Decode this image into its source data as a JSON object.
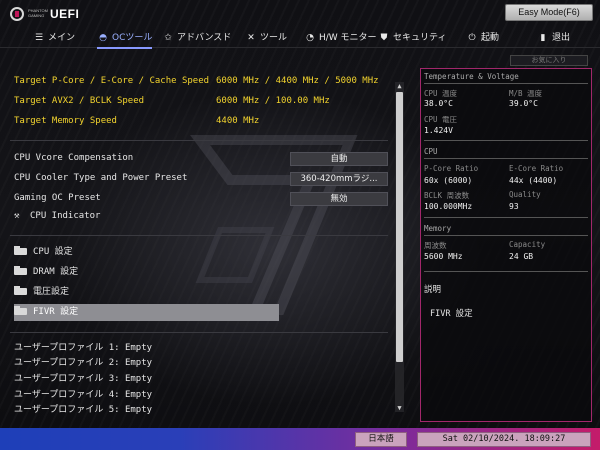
{
  "header": {
    "brand_small": "PHANTOM GAMING",
    "brand_title": "UEFI",
    "easy_mode_label": "Easy Mode(F6)"
  },
  "nav": {
    "tabs": [
      {
        "label": "メイン",
        "icon": "list-icon",
        "active": false
      },
      {
        "label": "OCツール",
        "icon": "speedometer-icon",
        "active": true
      },
      {
        "label": "アドバンスド",
        "icon": "star-icon",
        "active": false
      },
      {
        "label": "ツール",
        "icon": "tools-icon",
        "active": false
      },
      {
        "label": "H/W モニター",
        "icon": "monitor-gauge-icon",
        "active": false
      },
      {
        "label": "セキュリティ",
        "icon": "shield-icon",
        "active": false
      },
      {
        "label": "起動",
        "icon": "power-icon",
        "active": false
      },
      {
        "label": "退出",
        "icon": "exit-icon",
        "active": false
      }
    ],
    "favorites_label": "お気に入り"
  },
  "main": {
    "targets": [
      {
        "label": "Target P-Core / E-Core / Cache Speed",
        "value": "6000 MHz / 4400 MHz / 5000 MHz"
      },
      {
        "label": "Target AVX2 / BCLK Speed",
        "value": "6000 MHz / 100.00 MHz"
      },
      {
        "label": "Target Memory Speed",
        "value": "4400 MHz"
      }
    ],
    "options": [
      {
        "label": "CPU Vcore Compensation",
        "value": "自動"
      },
      {
        "label": "CPU Cooler Type and Power Preset",
        "value": "360-420mmラジ..."
      },
      {
        "label": "Gaming OC Preset",
        "value": "無効"
      }
    ],
    "cpu_indicator_label": "CPU Indicator",
    "folders": [
      {
        "label": "CPU 設定",
        "selected": false
      },
      {
        "label": "DRAM 設定",
        "selected": false
      },
      {
        "label": "電圧設定",
        "selected": false
      },
      {
        "label": "FIVR 設定",
        "selected": true
      }
    ],
    "profiles": [
      "ユーザープロファイル 1: Empty",
      "ユーザープロファイル 2: Empty",
      "ユーザープロファイル 3: Empty",
      "ユーザープロファイル 4: Empty",
      "ユーザープロファイル 5: Empty"
    ]
  },
  "panel": {
    "title": "Temperature & Voltage",
    "cpu_temp_label": "CPU 温度",
    "cpu_temp_value": "38.0°C",
    "mb_temp_label": "M/B 温度",
    "mb_temp_value": "39.0°C",
    "cpu_volt_label": "CPU 電圧",
    "cpu_volt_value": "1.424V",
    "cpu_section": "CPU",
    "pcore_label": "P-Core Ratio",
    "pcore_value": "60x (6000)",
    "ecore_label": "E-Core Ratio",
    "ecore_value": "44x (4400)",
    "bclk_label": "BCLK 周波数",
    "bclk_value": "100.000MHz",
    "quality_label": "Quality",
    "quality_value": "93",
    "mem_section": "Memory",
    "freq_label": "周波数",
    "freq_value": "5600 MHz",
    "cap_label": "Capacity",
    "cap_value": "24 GB",
    "desc_title": "説明",
    "desc_text": "FIVR 設定"
  },
  "footer": {
    "language": "日本語",
    "datetime": "Sat 02/10/2024. 18:09:27"
  },
  "colors": {
    "accent_yellow": "#f2d32e",
    "panel_border": "#a2276b",
    "bottom_gradient_start": "#1e3fb8",
    "bottom_gradient_end": "#c41c6a"
  }
}
